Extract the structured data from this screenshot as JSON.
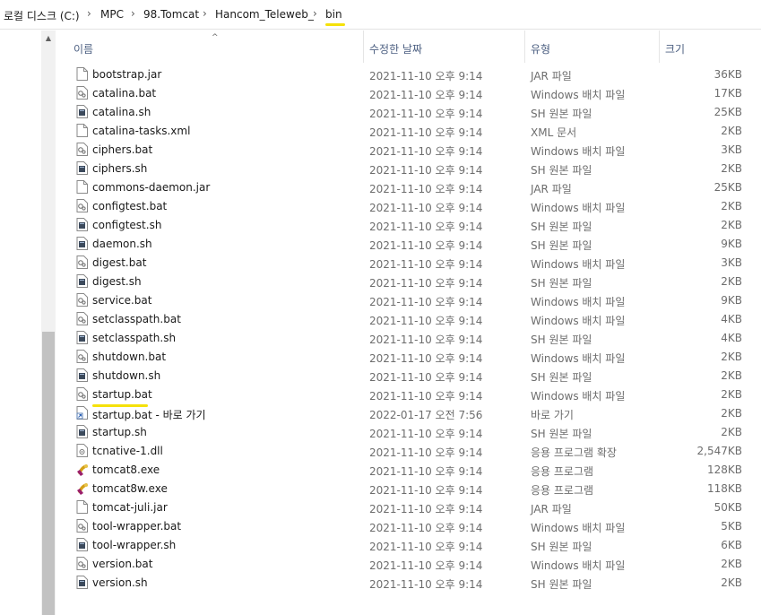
{
  "breadcrumb": {
    "items": [
      "로컬 디스크 (C:)",
      "MPC",
      "98.Tomcat",
      "Hancom_Teleweb_",
      "bin"
    ],
    "separator": "›"
  },
  "columns": {
    "name": "이름",
    "modified": "수정한 날짜",
    "type": "유형",
    "size": "크기"
  },
  "files": [
    {
      "name": "bootstrap.jar",
      "modified": "2021-11-10 오후 9:14",
      "type": "JAR 파일",
      "size": "36KB",
      "icon": "blank-file-icon"
    },
    {
      "name": "catalina.bat",
      "modified": "2021-11-10 오후 9:14",
      "type": "Windows 배치 파일",
      "size": "17KB",
      "icon": "batch-file-icon"
    },
    {
      "name": "catalina.sh",
      "modified": "2021-11-10 오후 9:14",
      "type": "SH 원본 파일",
      "size": "25KB",
      "icon": "shell-script-icon"
    },
    {
      "name": "catalina-tasks.xml",
      "modified": "2021-11-10 오후 9:14",
      "type": "XML 문서",
      "size": "2KB",
      "icon": "blank-file-icon"
    },
    {
      "name": "ciphers.bat",
      "modified": "2021-11-10 오후 9:14",
      "type": "Windows 배치 파일",
      "size": "3KB",
      "icon": "batch-file-icon"
    },
    {
      "name": "ciphers.sh",
      "modified": "2021-11-10 오후 9:14",
      "type": "SH 원본 파일",
      "size": "2KB",
      "icon": "shell-script-icon"
    },
    {
      "name": "commons-daemon.jar",
      "modified": "2021-11-10 오후 9:14",
      "type": "JAR 파일",
      "size": "25KB",
      "icon": "blank-file-icon"
    },
    {
      "name": "configtest.bat",
      "modified": "2021-11-10 오후 9:14",
      "type": "Windows 배치 파일",
      "size": "2KB",
      "icon": "batch-file-icon"
    },
    {
      "name": "configtest.sh",
      "modified": "2021-11-10 오후 9:14",
      "type": "SH 원본 파일",
      "size": "2KB",
      "icon": "shell-script-icon"
    },
    {
      "name": "daemon.sh",
      "modified": "2021-11-10 오후 9:14",
      "type": "SH 원본 파일",
      "size": "9KB",
      "icon": "shell-script-icon"
    },
    {
      "name": "digest.bat",
      "modified": "2021-11-10 오후 9:14",
      "type": "Windows 배치 파일",
      "size": "3KB",
      "icon": "batch-file-icon"
    },
    {
      "name": "digest.sh",
      "modified": "2021-11-10 오후 9:14",
      "type": "SH 원본 파일",
      "size": "2KB",
      "icon": "shell-script-icon"
    },
    {
      "name": "service.bat",
      "modified": "2021-11-10 오후 9:14",
      "type": "Windows 배치 파일",
      "size": "9KB",
      "icon": "batch-file-icon"
    },
    {
      "name": "setclasspath.bat",
      "modified": "2021-11-10 오후 9:14",
      "type": "Windows 배치 파일",
      "size": "4KB",
      "icon": "batch-file-icon"
    },
    {
      "name": "setclasspath.sh",
      "modified": "2021-11-10 오후 9:14",
      "type": "SH 원본 파일",
      "size": "4KB",
      "icon": "shell-script-icon"
    },
    {
      "name": "shutdown.bat",
      "modified": "2021-11-10 오후 9:14",
      "type": "Windows 배치 파일",
      "size": "2KB",
      "icon": "batch-file-icon"
    },
    {
      "name": "shutdown.sh",
      "modified": "2021-11-10 오후 9:14",
      "type": "SH 원본 파일",
      "size": "2KB",
      "icon": "shell-script-icon"
    },
    {
      "name": "startup.bat",
      "modified": "2021-11-10 오후 9:14",
      "type": "Windows 배치 파일",
      "size": "2KB",
      "icon": "batch-file-icon"
    },
    {
      "name": "startup.bat - 바로 가기",
      "modified": "2022-01-17 오전 7:56",
      "type": "바로 가기",
      "size": "2KB",
      "icon": "shortcut-icon"
    },
    {
      "name": "startup.sh",
      "modified": "2021-11-10 오후 9:14",
      "type": "SH 원본 파일",
      "size": "2KB",
      "icon": "shell-script-icon"
    },
    {
      "name": "tcnative-1.dll",
      "modified": "2021-11-10 오후 9:14",
      "type": "응용 프로그램 확장",
      "size": "2,547KB",
      "icon": "dll-file-icon"
    },
    {
      "name": "tomcat8.exe",
      "modified": "2021-11-10 오후 9:14",
      "type": "응용 프로그램",
      "size": "128KB",
      "icon": "tomcat-app-icon"
    },
    {
      "name": "tomcat8w.exe",
      "modified": "2021-11-10 오후 9:14",
      "type": "응용 프로그램",
      "size": "118KB",
      "icon": "tomcat-app-icon"
    },
    {
      "name": "tomcat-juli.jar",
      "modified": "2021-11-10 오후 9:14",
      "type": "JAR 파일",
      "size": "50KB",
      "icon": "blank-file-icon"
    },
    {
      "name": "tool-wrapper.bat",
      "modified": "2021-11-10 오후 9:14",
      "type": "Windows 배치 파일",
      "size": "5KB",
      "icon": "batch-file-icon"
    },
    {
      "name": "tool-wrapper.sh",
      "modified": "2021-11-10 오후 9:14",
      "type": "SH 원본 파일",
      "size": "6KB",
      "icon": "shell-script-icon"
    },
    {
      "name": "version.bat",
      "modified": "2021-11-10 오후 9:14",
      "type": "Windows 배치 파일",
      "size": "2KB",
      "icon": "batch-file-icon"
    },
    {
      "name": "version.sh",
      "modified": "2021-11-10 오후 9:14",
      "type": "SH 원본 파일",
      "size": "2KB",
      "icon": "shell-script-icon"
    }
  ],
  "colors": {
    "highlight": "#f5e10a",
    "header_text": "#4d6082",
    "secondary_text": "#6d6d6d"
  }
}
